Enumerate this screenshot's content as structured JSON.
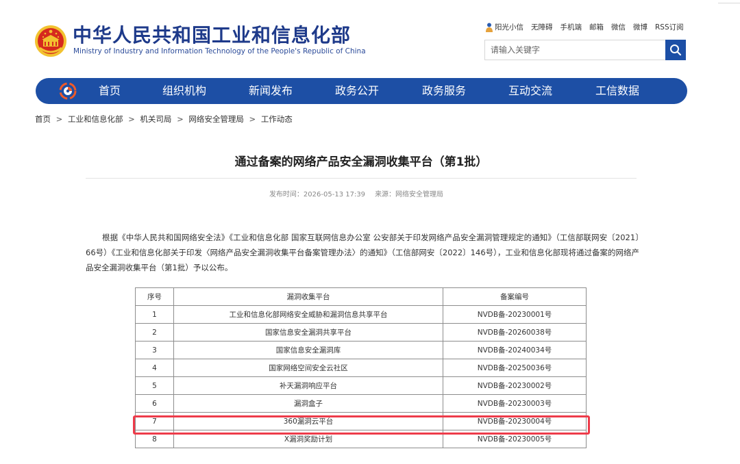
{
  "site": {
    "name_cn": "中华人民共和国工业和信息化部",
    "name_en": "Ministry of Industry and Information Technology of the People's Republic of China"
  },
  "top_links": [
    "阳光小信",
    "无障碍",
    "手机端",
    "邮箱",
    "微信",
    "微博",
    "RSS订阅"
  ],
  "search": {
    "placeholder": "请输入关键字"
  },
  "nav": [
    "首页",
    "组织机构",
    "新闻发布",
    "政务公开",
    "政务服务",
    "互动交流",
    "工信数据"
  ],
  "breadcrumb": [
    "首页",
    "工业和信息化部",
    "机关司局",
    "网络安全管理局",
    "工作动态"
  ],
  "breadcrumb_separator": ">",
  "article": {
    "title": "通过备案的网络产品安全漏洞收集平台（第1批）",
    "published": "发布时间：2026-05-13 17:39",
    "source": "来源：网络安全管理局",
    "paragraph": "根据《中华人民共和国网络安全法》《工业和信息化部 国家互联网信息办公室 公安部关于印发网络产品安全漏洞管理规定的通知》（工信部联网安〔2021〕66号）《工业和信息化部关于印发〈网络产品安全漏洞收集平台备案管理办法〉的通知》（工信部网安〔2022〕146号），工业和信息化部现将通过备案的网络产品安全漏洞收集平台（第1批）予以公布。"
  },
  "table": {
    "headers": [
      "序号",
      "漏洞收集平台",
      "备案编号"
    ],
    "rows": [
      [
        "1",
        "工业和信息化部网络安全威胁和漏洞信息共享平台",
        "NVDB备-20230001号"
      ],
      [
        "2",
        "国家信息安全漏洞共享平台",
        "NVDB备-20260038号"
      ],
      [
        "3",
        "国家信息安全漏洞库",
        "NVDB备-20240034号"
      ],
      [
        "4",
        "国家网络空间安全云社区",
        "NVDB备-20250036号"
      ],
      [
        "5",
        "补天漏洞响应平台",
        "NVDB备-20230002号"
      ],
      [
        "6",
        "漏洞盒子",
        "NVDB备-20230003号"
      ],
      [
        "7",
        "360漏洞云平台",
        "NVDB备-20230004号"
      ],
      [
        "8",
        "X漏洞奖励计划",
        "NVDB备-20230005号"
      ]
    ],
    "highlighted_row": 7
  },
  "colors": {
    "nav_blue": "#1d4fa5",
    "title_blue": "#1e3a8a",
    "highlight_red": "#ee3b4a",
    "emblem_red": "#d62a1e",
    "emblem_gold": "#f2c230"
  },
  "icons": [
    "national-emblem-icon",
    "person-icon",
    "search-icon",
    "swirl-logo-icon"
  ]
}
